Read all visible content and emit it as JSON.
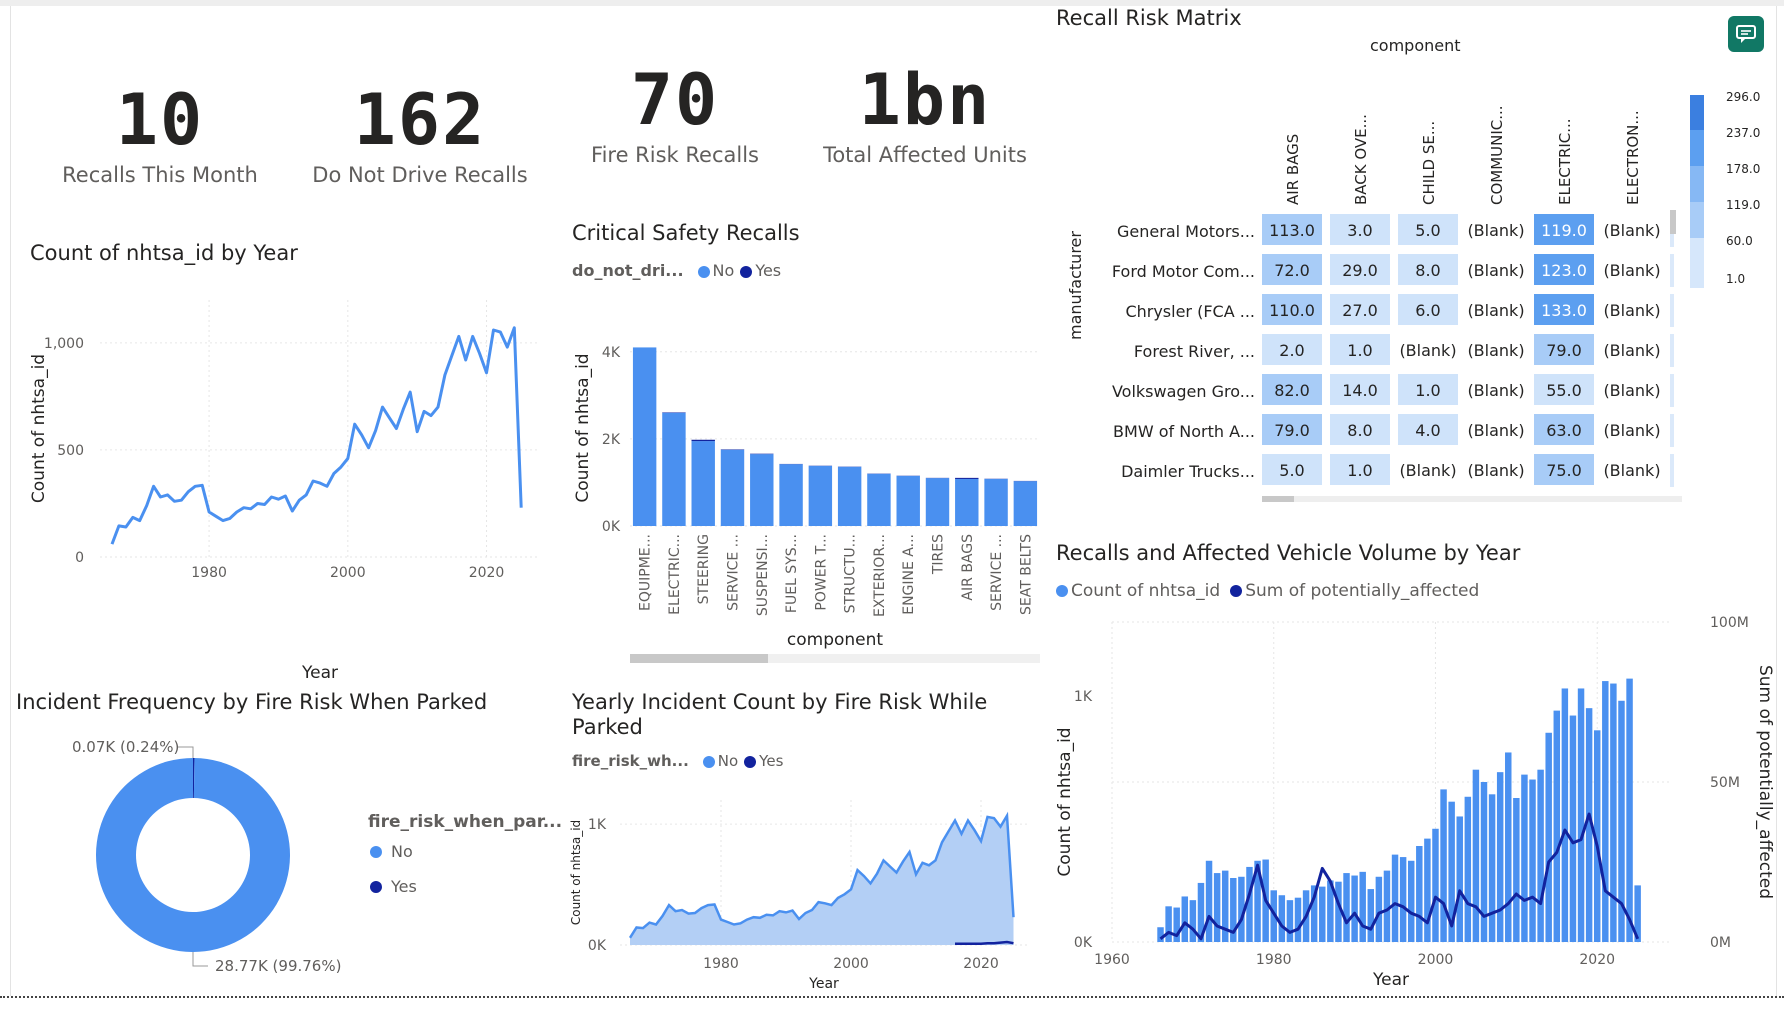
{
  "kpis": [
    {
      "value": "10",
      "label": "Recalls This Month"
    },
    {
      "value": "162",
      "label": "Do Not Drive Recalls"
    },
    {
      "value": "70",
      "label": "Fire Risk Recalls"
    },
    {
      "value": "1bn",
      "label": "Total Affected Units"
    }
  ],
  "colors": {
    "light": "#4a90f0",
    "dark": "#12239e",
    "area": "#b3cff5",
    "grid": "#e6e6e6"
  },
  "year_chart": {
    "title": "Count of nhtsa_id by Year",
    "xlabel": "Year",
    "ylabel": "Count of nhtsa_id",
    "yticks": [
      "0",
      "500",
      "1,000"
    ],
    "xticks": [
      "1980",
      "2000",
      "2020"
    ]
  },
  "critical": {
    "title": "Critical Safety Recalls",
    "legend_title": "do_not_dri...",
    "legend": [
      "No",
      "Yes"
    ],
    "ylabel": "Count of nhtsa_id",
    "xlabel": "component",
    "yticks": [
      "0K",
      "2K",
      "4K"
    ],
    "categories": [
      "EQUIPME...",
      "ELECTRIC...",
      "STEERING",
      "SERVICE ...",
      "SUSPENSI...",
      "FUEL SYS...",
      "POWER T...",
      "STRUCTU...",
      "EXTERIOR...",
      "ENGINE A...",
      "TIRES",
      "AIR BAGS",
      "SERVICE ...",
      "SEAT BELTS"
    ]
  },
  "matrix": {
    "title": "Recall Risk Matrix",
    "col_title": "component",
    "row_title": "manufacturer",
    "columns": [
      "AIR BAGS",
      "BACK OVE...",
      "CHILD SE...",
      "COMMUNIC...",
      "ELECTRIC...",
      "ELECTRON..."
    ],
    "rows": [
      {
        "name": "General Motors...",
        "values": [
          "113.0",
          "3.0",
          "5.0",
          "(Blank)",
          "119.0",
          "(Blank)"
        ]
      },
      {
        "name": "Ford Motor Com...",
        "values": [
          "72.0",
          "29.0",
          "8.0",
          "(Blank)",
          "123.0",
          "(Blank)"
        ]
      },
      {
        "name": "Chrysler (FCA ...",
        "values": [
          "110.0",
          "27.0",
          "6.0",
          "(Blank)",
          "133.0",
          "(Blank)"
        ]
      },
      {
        "name": "Forest River, ...",
        "values": [
          "2.0",
          "1.0",
          "(Blank)",
          "(Blank)",
          "79.0",
          "(Blank)"
        ]
      },
      {
        "name": "Volkswagen Gro...",
        "values": [
          "82.0",
          "14.0",
          "1.0",
          "(Blank)",
          "55.0",
          "(Blank)"
        ]
      },
      {
        "name": "BMW of North A...",
        "values": [
          "79.0",
          "8.0",
          "4.0",
          "(Blank)",
          "63.0",
          "(Blank)"
        ]
      },
      {
        "name": "Daimler Trucks...",
        "values": [
          "5.0",
          "1.0",
          "(Blank)",
          "(Blank)",
          "75.0",
          "(Blank)"
        ]
      }
    ],
    "scale": [
      "296.0",
      "237.0",
      "178.0",
      "119.0",
      "60.0",
      "1.0"
    ]
  },
  "donut": {
    "title": "Incident Frequency by Fire Risk When Parked",
    "legend_title": "fire_risk_when_par...",
    "legend": [
      "No",
      "Yes"
    ],
    "label_yes": "0.07K (0.24%)",
    "label_no": "28.77K (99.76%)"
  },
  "yearly_fire": {
    "title_line1": "Yearly Incident Count by Fire Risk While",
    "title_line2": "Parked",
    "legend_title": "fire_risk_wh...",
    "legend": [
      "No",
      "Yes"
    ],
    "ylabel": "Count of nhtsa_id",
    "xlabel": "Year",
    "yticks": [
      "0K",
      "1K"
    ],
    "xticks": [
      "1980",
      "2000",
      "2020"
    ]
  },
  "combo": {
    "title": "Recalls and Affected Vehicle Volume by Year",
    "legend": [
      "Count of nhtsa_id",
      "Sum of potentially_affected"
    ],
    "ylabel": "Count of nhtsa_id",
    "y2label": "Sum of potentially_affected",
    "xlabel": "Year",
    "yticks": [
      "0K",
      "1K"
    ],
    "y2ticks": [
      "0M",
      "50M",
      "100M"
    ],
    "xticks": [
      "1960",
      "1980",
      "2000",
      "2020"
    ]
  },
  "chart_data": [
    {
      "type": "line",
      "title": "Count of nhtsa_id by Year",
      "xlabel": "Year",
      "ylabel": "Count of nhtsa_id",
      "ylim": [
        0,
        1200
      ],
      "x": [
        1966,
        1967,
        1968,
        1969,
        1970,
        1971,
        1972,
        1973,
        1974,
        1975,
        1976,
        1977,
        1978,
        1979,
        1980,
        1981,
        1982,
        1983,
        1984,
        1985,
        1986,
        1987,
        1988,
        1989,
        1990,
        1991,
        1992,
        1993,
        1994,
        1995,
        1996,
        1997,
        1998,
        1999,
        2000,
        2001,
        2002,
        2003,
        2004,
        2005,
        2006,
        2007,
        2008,
        2009,
        2010,
        2011,
        2012,
        2013,
        2014,
        2015,
        2016,
        2017,
        2018,
        2019,
        2020,
        2021,
        2022,
        2023,
        2024,
        2025
      ],
      "y": [
        60,
        145,
        140,
        185,
        170,
        240,
        330,
        280,
        290,
        260,
        265,
        305,
        330,
        335,
        210,
        190,
        170,
        180,
        210,
        230,
        225,
        250,
        245,
        280,
        270,
        285,
        215,
        265,
        290,
        355,
        345,
        330,
        390,
        420,
        460,
        620,
        570,
        510,
        590,
        700,
        650,
        600,
        690,
        770,
        585,
        680,
        660,
        700,
        850,
        940,
        1030,
        920,
        1030,
        950,
        860,
        1060,
        1050,
        980,
        1070,
        230
      ]
    },
    {
      "type": "bar",
      "title": "Critical Safety Recalls",
      "xlabel": "component",
      "ylabel": "Count of nhtsa_id",
      "ylim": [
        0,
        4500
      ],
      "categories": [
        "EQUIPME...",
        "ELECTRIC...",
        "STEERING",
        "SERVICE ...",
        "SUSPENSI...",
        "FUEL SYS...",
        "POWER T...",
        "STRUCTU...",
        "EXTERIOR...",
        "ENGINE A...",
        "TIRES",
        "AIR BAGS",
        "SERVICE ...",
        "SEAT BELTS"
      ],
      "series": [
        {
          "name": "No",
          "values": [
            4100,
            2600,
            1950,
            1750,
            1650,
            1420,
            1380,
            1360,
            1200,
            1150,
            1100,
            1080,
            1080,
            1030
          ]
        },
        {
          "name": "Yes",
          "values": [
            0,
            10,
            30,
            10,
            10,
            5,
            5,
            5,
            5,
            5,
            5,
            25,
            5,
            5
          ]
        }
      ]
    },
    {
      "type": "pie",
      "title": "Incident Frequency by Fire Risk When Parked",
      "categories": [
        "No",
        "Yes"
      ],
      "values": [
        28.77,
        0.07
      ]
    },
    {
      "type": "area",
      "title": "Yearly Incident Count by Fire Risk While Parked",
      "xlabel": "Year",
      "ylabel": "Count of nhtsa_id",
      "ylim": [
        0,
        1200
      ],
      "x": [
        1966,
        1967,
        1968,
        1969,
        1970,
        1971,
        1972,
        1973,
        1974,
        1975,
        1976,
        1977,
        1978,
        1979,
        1980,
        1981,
        1982,
        1983,
        1984,
        1985,
        1986,
        1987,
        1988,
        1989,
        1990,
        1991,
        1992,
        1993,
        1994,
        1995,
        1996,
        1997,
        1998,
        1999,
        2000,
        2001,
        2002,
        2003,
        2004,
        2005,
        2006,
        2007,
        2008,
        2009,
        2010,
        2011,
        2012,
        2013,
        2014,
        2015,
        2016,
        2017,
        2018,
        2019,
        2020,
        2021,
        2022,
        2023,
        2024,
        2025
      ],
      "series": [
        {
          "name": "No",
          "values": [
            60,
            145,
            140,
            185,
            170,
            240,
            330,
            280,
            290,
            260,
            265,
            305,
            330,
            335,
            210,
            190,
            170,
            180,
            210,
            230,
            225,
            250,
            245,
            280,
            270,
            285,
            215,
            265,
            290,
            355,
            345,
            330,
            390,
            420,
            460,
            620,
            570,
            510,
            590,
            700,
            650,
            600,
            690,
            770,
            585,
            680,
            660,
            700,
            850,
            940,
            1030,
            920,
            1030,
            950,
            860,
            1060,
            1050,
            980,
            1070,
            230
          ]
        },
        {
          "name": "Yes",
          "values": [
            0,
            0,
            0,
            0,
            0,
            0,
            0,
            0,
            0,
            0,
            0,
            0,
            0,
            0,
            0,
            0,
            0,
            0,
            0,
            0,
            0,
            0,
            0,
            0,
            0,
            0,
            0,
            0,
            0,
            0,
            0,
            0,
            0,
            0,
            0,
            0,
            0,
            0,
            0,
            0,
            0,
            0,
            0,
            0,
            0,
            0,
            0,
            0,
            0,
            0,
            10,
            10,
            10,
            10,
            10,
            15,
            15,
            20,
            25,
            15
          ]
        }
      ]
    },
    {
      "type": "bar",
      "title": "Recalls and Affected Vehicle Volume by Year",
      "xlabel": "Year",
      "ylabel": "Count of nhtsa_id",
      "y2label": "Sum of potentially_affected",
      "ylim": [
        0,
        1300
      ],
      "y2lim": [
        0,
        100
      ],
      "x": [
        1966,
        1967,
        1968,
        1969,
        1970,
        1971,
        1972,
        1973,
        1974,
        1975,
        1976,
        1977,
        1978,
        1979,
        1980,
        1981,
        1982,
        1983,
        1984,
        1985,
        1986,
        1987,
        1988,
        1989,
        1990,
        1991,
        1992,
        1993,
        1994,
        1995,
        1996,
        1997,
        1998,
        1999,
        2000,
        2001,
        2002,
        2003,
        2004,
        2005,
        2006,
        2007,
        2008,
        2009,
        2010,
        2011,
        2012,
        2013,
        2014,
        2015,
        2016,
        2017,
        2018,
        2019,
        2020,
        2021,
        2022,
        2023,
        2024,
        2025
      ],
      "series": [
        {
          "name": "Count of nhtsa_id",
          "values": [
            60,
            145,
            140,
            185,
            170,
            240,
            330,
            280,
            290,
            260,
            265,
            305,
            330,
            335,
            210,
            190,
            170,
            180,
            210,
            230,
            225,
            250,
            245,
            280,
            270,
            285,
            215,
            265,
            290,
            355,
            345,
            330,
            390,
            420,
            460,
            620,
            570,
            510,
            590,
            700,
            650,
            600,
            690,
            770,
            585,
            680,
            660,
            700,
            850,
            940,
            1030,
            920,
            1030,
            950,
            860,
            1060,
            1050,
            980,
            1070,
            230
          ]
        },
        {
          "name": "Sum of potentially_affected",
          "values": [
            1,
            3,
            2,
            6,
            4,
            1,
            8,
            5,
            4,
            3,
            7,
            15,
            24,
            13,
            9,
            5,
            3,
            4,
            8,
            14,
            23,
            19,
            12,
            6,
            9,
            5,
            4,
            9,
            10,
            12,
            11,
            9,
            8,
            6,
            14,
            12,
            5,
            16,
            12,
            11,
            8,
            9,
            10,
            12,
            15,
            13,
            14,
            12,
            25,
            28,
            35,
            31,
            32,
            40,
            30,
            16,
            14,
            12,
            7,
            1
          ]
        }
      ]
    },
    {
      "type": "heatmap",
      "title": "Recall Risk Matrix",
      "xlabel": "component",
      "ylabel": "manufacturer",
      "categories": [
        "AIR BAGS",
        "BACK OVE...",
        "CHILD SE...",
        "COMMUNIC...",
        "ELECTRIC...",
        "ELECTRON..."
      ],
      "rows": [
        "General Motors...",
        "Ford Motor Com...",
        "Chrysler (FCA ...",
        "Forest River, ...",
        "Volkswagen Gro...",
        "BMW of North A...",
        "Daimler Trucks..."
      ],
      "values": [
        [
          113,
          3,
          5,
          null,
          119,
          null
        ],
        [
          72,
          29,
          8,
          null,
          123,
          null
        ],
        [
          110,
          27,
          6,
          null,
          133,
          null
        ],
        [
          2,
          1,
          null,
          null,
          79,
          null
        ],
        [
          82,
          14,
          1,
          null,
          55,
          null
        ],
        [
          79,
          8,
          4,
          null,
          63,
          null
        ],
        [
          5,
          1,
          null,
          null,
          75,
          null
        ]
      ]
    }
  ]
}
